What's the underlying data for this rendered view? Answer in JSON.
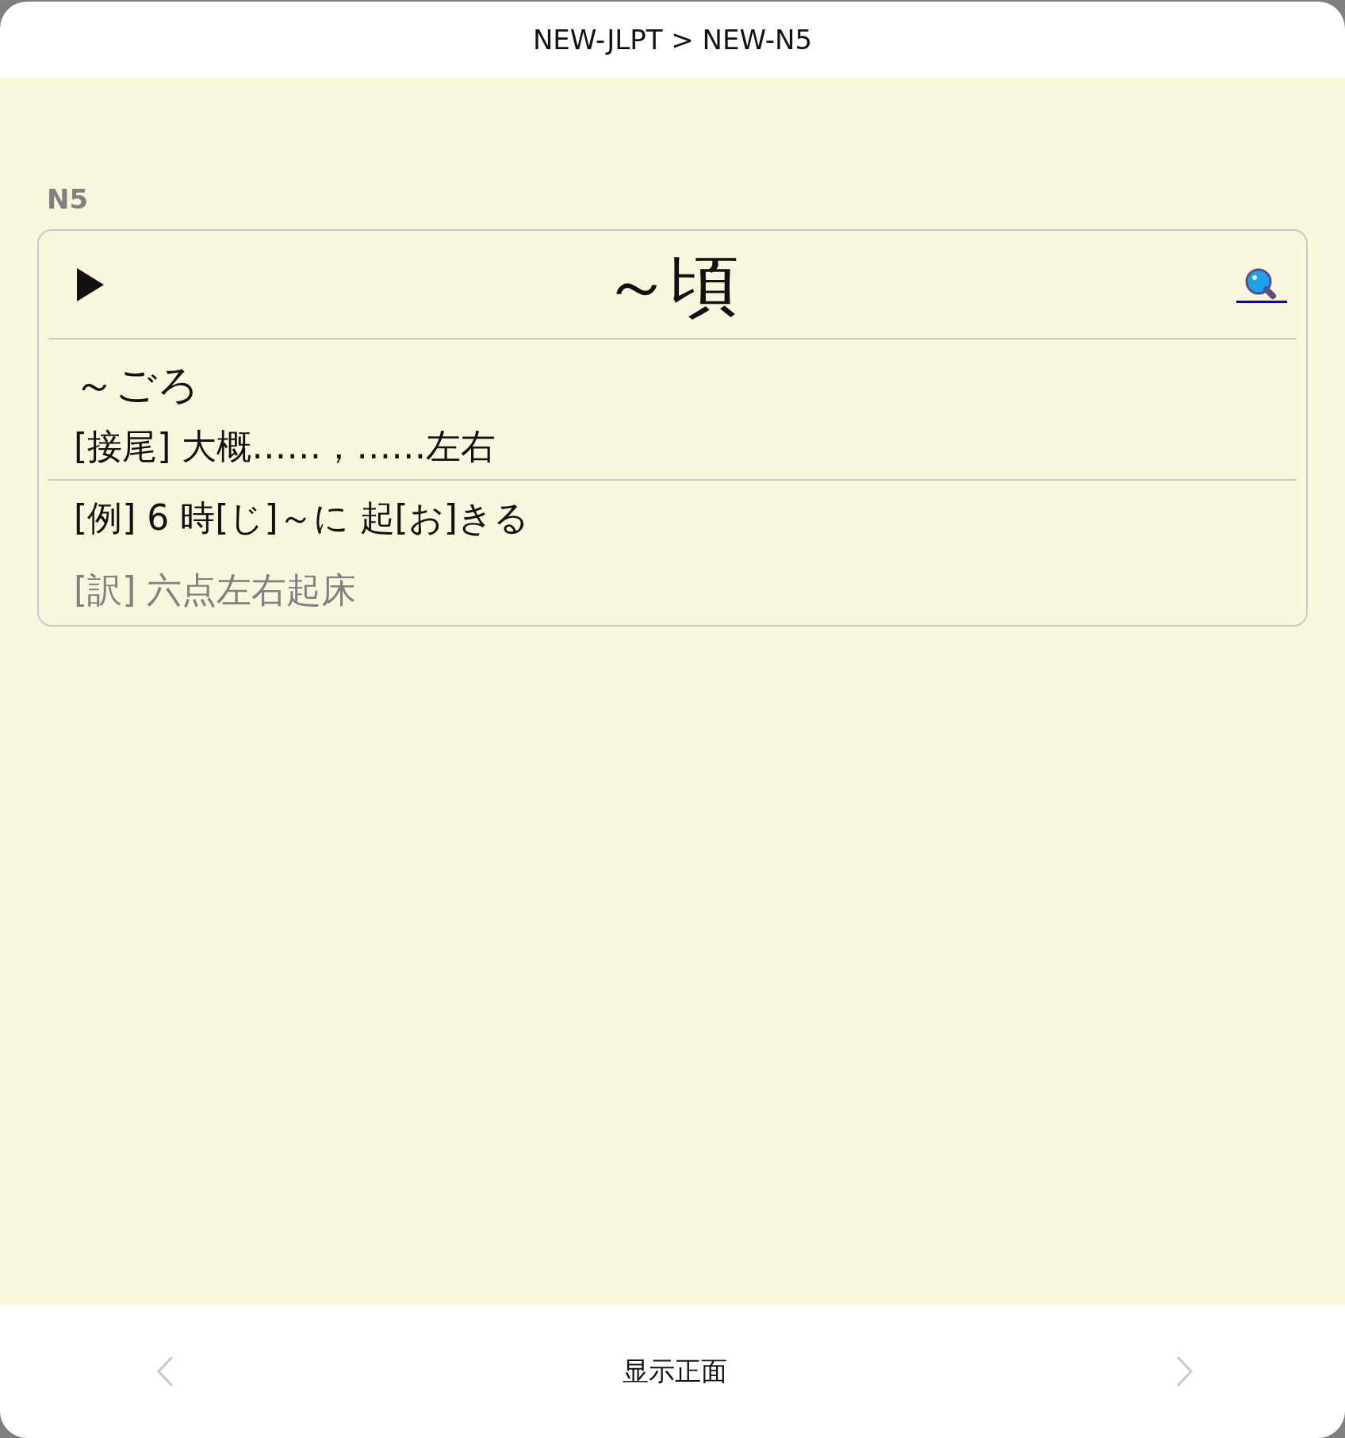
{
  "header": {
    "title": "NEW-JLPT > NEW-N5"
  },
  "level_label": "N5",
  "card": {
    "word": "～頃",
    "reading": "～ごろ",
    "meaning": "[接尾]  大概……，……左右",
    "example": "[例]  6 時[じ]～に 起[お]きる",
    "translation": "[訳]  六点左右起床"
  },
  "footer": {
    "toggle": "显示正面"
  }
}
